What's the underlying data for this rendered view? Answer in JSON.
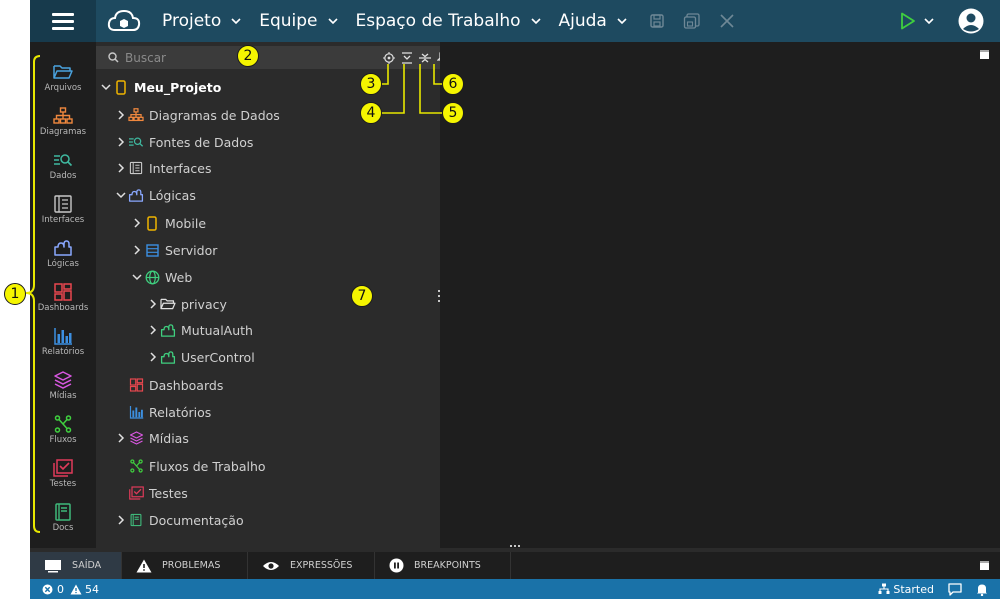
{
  "topbar": {
    "menus": [
      {
        "label": "Projeto"
      },
      {
        "label": "Equipe"
      },
      {
        "label": "Espaço de Trabalho"
      },
      {
        "label": "Ajuda"
      }
    ]
  },
  "activity": {
    "items": [
      {
        "label": "Arquivos",
        "icon": "folder-open-icon",
        "color": "#4aa3df"
      },
      {
        "label": "Diagramas",
        "icon": "diagram-icon",
        "color": "#f0883e"
      },
      {
        "label": "Dados",
        "icon": "data-search-icon",
        "color": "#3fb9a0"
      },
      {
        "label": "Interfaces",
        "icon": "interface-icon",
        "color": "#c8c8c8"
      },
      {
        "label": "Lógicas",
        "icon": "puzzle-icon",
        "color": "#8aa8ff"
      },
      {
        "label": "Dashboards",
        "icon": "dashboard-icon",
        "color": "#e8474f"
      },
      {
        "label": "Relatórios",
        "icon": "bar-chart-icon",
        "color": "#3c8fe0"
      },
      {
        "label": "Mídias",
        "icon": "layers-icon",
        "color": "#d857e0"
      },
      {
        "label": "Fluxos",
        "icon": "flow-icon",
        "color": "#3fcf3f"
      },
      {
        "label": "Testes",
        "icon": "test-check-icon",
        "color": "#e03a5a"
      },
      {
        "label": "Docs",
        "icon": "book-icon",
        "color": "#3fb97a"
      }
    ]
  },
  "search": {
    "placeholder": "Buscar"
  },
  "tree": {
    "root": "Meu_Projeto",
    "items": [
      {
        "label": "Diagramas de Dados"
      },
      {
        "label": "Fontes de Dados"
      },
      {
        "label": "Interfaces"
      },
      {
        "label": "Lógicas"
      },
      {
        "label": "Mobile"
      },
      {
        "label": "Servidor"
      },
      {
        "label": "Web"
      },
      {
        "label": "privacy"
      },
      {
        "label": "MutualAuth"
      },
      {
        "label": "UserControl"
      },
      {
        "label": "Dashboards"
      },
      {
        "label": "Relatórios"
      },
      {
        "label": "Mídias"
      },
      {
        "label": "Fluxos de Trabalho"
      },
      {
        "label": "Testes"
      },
      {
        "label": "Documentação"
      }
    ]
  },
  "panel_tabs": [
    {
      "label": "SAÍDA"
    },
    {
      "label": "PROBLEMAS"
    },
    {
      "label": "EXPRESSÕES"
    },
    {
      "label": "BREAKPOINTS"
    }
  ],
  "status": {
    "errors": "0",
    "warnings": "54",
    "server_status": "Started"
  },
  "callouts": [
    "1",
    "2",
    "3",
    "4",
    "5",
    "6",
    "7"
  ],
  "colors": {
    "topbar": "#1e4a60",
    "statusbar": "#1a72a8",
    "callout": "#f5f500",
    "run": "#3fcf3f"
  }
}
